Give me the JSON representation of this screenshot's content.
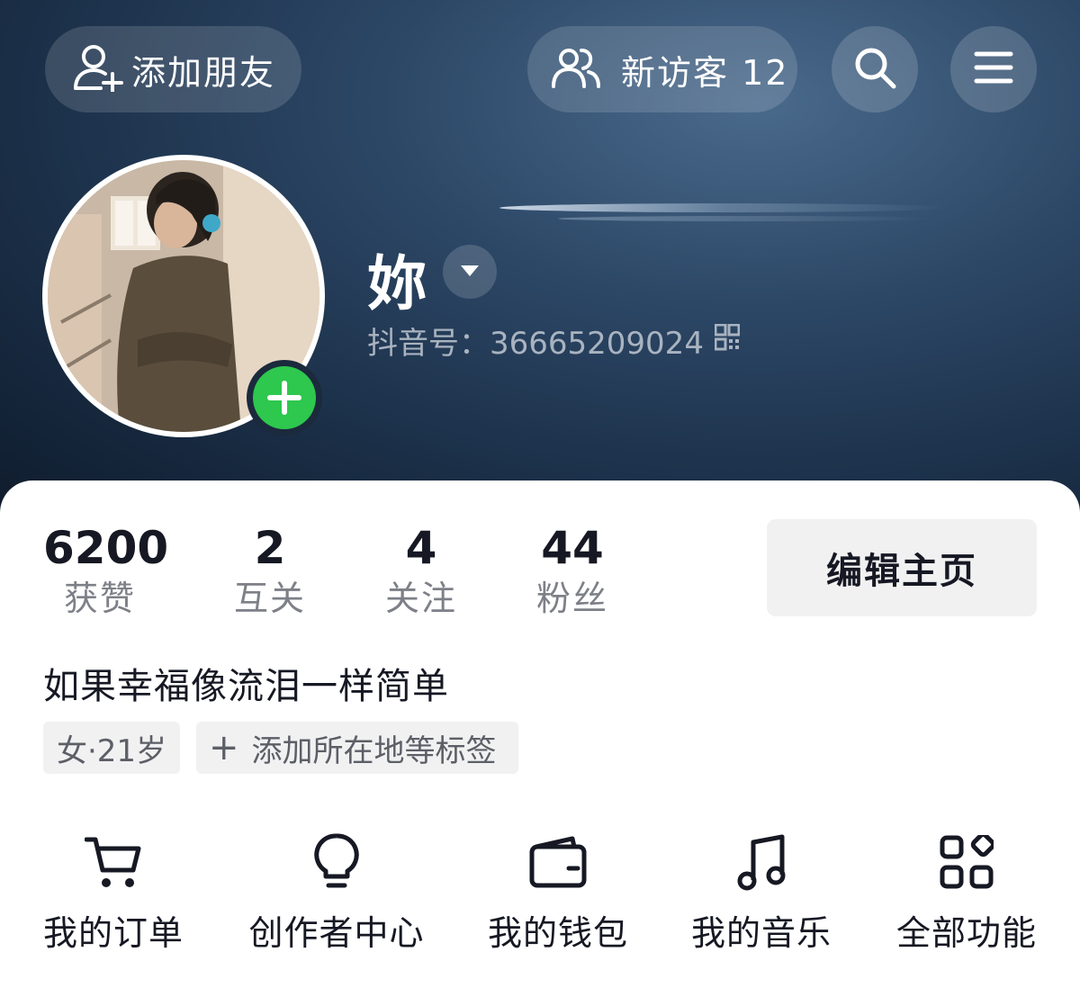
{
  "header": {
    "add_friend_label": "添加朋友",
    "add_friend_icon": "add-user-icon",
    "visitors_label": "新访客 12",
    "visitors_icon": "users-icon",
    "search_icon": "search-icon",
    "menu_icon": "menu-icon"
  },
  "profile": {
    "nickname": "妳",
    "id_label": "抖音号：36665209024",
    "avatar_icon": "avatar",
    "add_badge_icon": "plus-icon"
  },
  "stats": [
    {
      "value": "6200",
      "label": "获赞"
    },
    {
      "value": "2",
      "label": "互关"
    },
    {
      "value": "4",
      "label": "关注"
    },
    {
      "value": "44",
      "label": "粉丝"
    }
  ],
  "edit_button": "编辑主页",
  "bio": "如果幸福像流泪一样简单",
  "tags": {
    "gender_age": "女·21岁",
    "add_tag": "添加所在地等标签"
  },
  "functions": [
    {
      "label": "我的订单",
      "icon": "cart-icon"
    },
    {
      "label": "创作者中心",
      "icon": "bulb-icon"
    },
    {
      "label": "我的钱包",
      "icon": "wallet-icon"
    },
    {
      "label": "我的音乐",
      "icon": "music-icon"
    },
    {
      "label": "全部功能",
      "icon": "grid-icon"
    }
  ],
  "colors": {
    "accent_green": "#2dc84d",
    "text_primary": "#161823",
    "text_secondary": "#7e8088",
    "chip_bg": "#f1f1f2"
  }
}
